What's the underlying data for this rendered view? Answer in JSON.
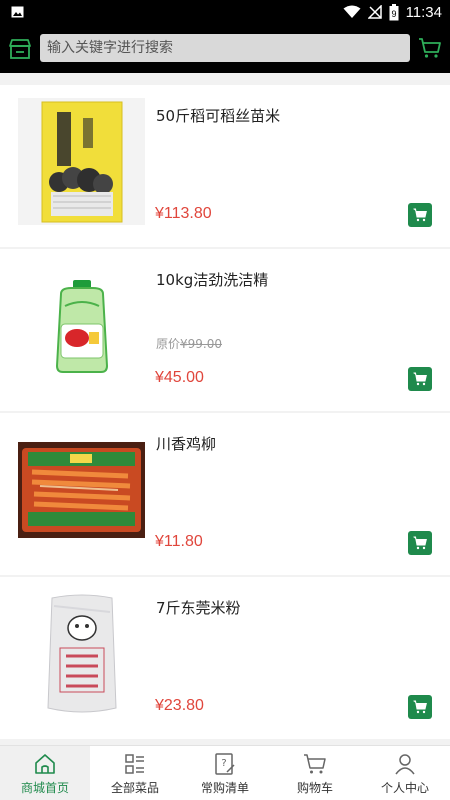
{
  "status_bar": {
    "time": "11:34",
    "battery_level": "9"
  },
  "header": {
    "search_placeholder": "输入关键字进行搜索"
  },
  "products": [
    {
      "name": "50斤稻可稻丝苗米",
      "price": "¥113.80",
      "original_price_label": "",
      "original_price": "",
      "image": "rice-bag"
    },
    {
      "name": "10kg洁劲洗洁精",
      "price": "¥45.00",
      "original_price_label": "原价",
      "original_price": "¥99.00",
      "image": "detergent-bottle"
    },
    {
      "name": "川香鸡柳",
      "price": "¥11.80",
      "original_price_label": "",
      "original_price": "",
      "image": "chicken-strips-pack"
    },
    {
      "name": "7斤东莞米粉",
      "price": "¥23.80",
      "original_price_label": "",
      "original_price": "",
      "image": "rice-noodle-bag"
    }
  ],
  "tabbar": {
    "tabs": [
      {
        "label": "商城首页",
        "icon": "home-icon",
        "active": true
      },
      {
        "label": "全部菜品",
        "icon": "category-list-icon",
        "active": false
      },
      {
        "label": "常购清单",
        "icon": "frequent-list-icon",
        "active": false
      },
      {
        "label": "购物车",
        "icon": "cart-icon",
        "active": false
      },
      {
        "label": "个人中心",
        "icon": "person-icon",
        "active": false
      }
    ]
  },
  "colors": {
    "accent_green": "#1f8a4c",
    "price_red": "#e0463c"
  }
}
